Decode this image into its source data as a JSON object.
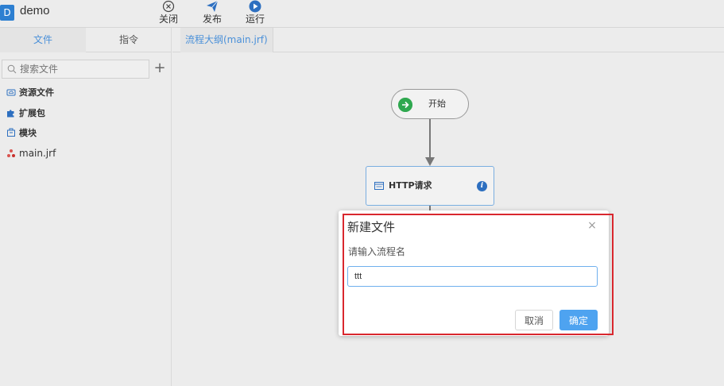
{
  "app": {
    "logo_letter": "D",
    "title": "demo"
  },
  "toolbar": {
    "close_label": "关闭",
    "publish_label": "发布",
    "run_label": "运行"
  },
  "sidebar": {
    "tabs": [
      {
        "label": "文件",
        "active": true
      },
      {
        "label": "指令",
        "active": false
      }
    ],
    "search": {
      "placeholder": "搜索文件",
      "value": ""
    },
    "add_label": "+",
    "items": [
      {
        "label": "资源文件",
        "icon": "cloud-folder-icon"
      },
      {
        "label": "扩展包",
        "icon": "puzzle-icon"
      },
      {
        "label": "模块",
        "icon": "module-box-icon"
      },
      {
        "label": "main.jrf",
        "icon": "flow-file-icon"
      }
    ]
  },
  "editor": {
    "tabs": [
      {
        "label": "流程大纲(main.jrf)",
        "active": true
      }
    ]
  },
  "flow": {
    "nodes": [
      {
        "label": "开始",
        "type": "start"
      },
      {
        "label": "HTTP请求",
        "type": "http-request"
      }
    ]
  },
  "dialog": {
    "title": "新建文件",
    "close_label": "×",
    "prompt": "请输入流程名",
    "input_value": "ttt",
    "cancel_label": "取消",
    "ok_label": "确定"
  },
  "colors": {
    "accent": "#4ea3f0",
    "tab_active": "#4a90d9",
    "start_green": "#2fa84f",
    "highlight_red": "#d9272e"
  }
}
